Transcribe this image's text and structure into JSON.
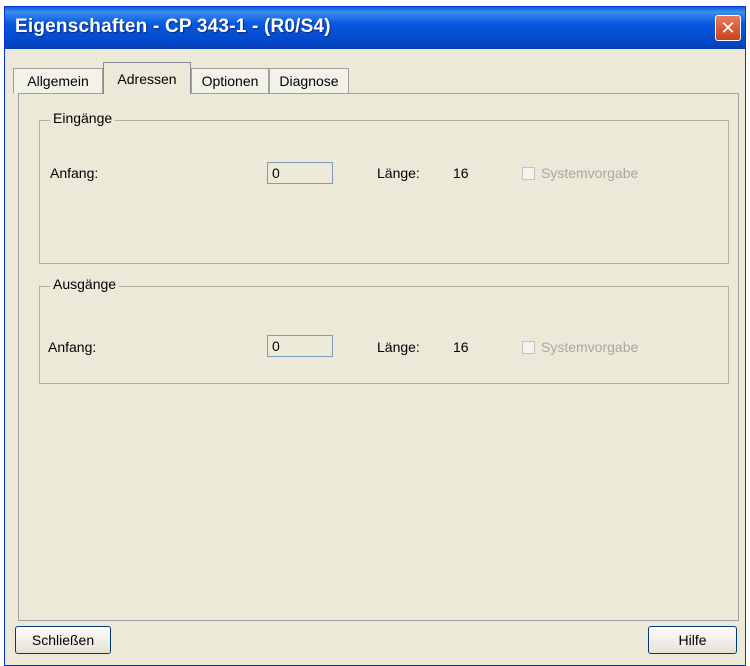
{
  "window": {
    "title": "Eigenschaften - CP 343-1 - (R0/S4)",
    "close_glyph": "✕"
  },
  "tabs": [
    {
      "label": "Allgemein",
      "active": false
    },
    {
      "label": "Adressen",
      "active": true
    },
    {
      "label": "Optionen",
      "active": false
    },
    {
      "label": "Diagnose",
      "active": false
    }
  ],
  "inputs_group": {
    "title": "Eingänge",
    "start_label": "Anfang:",
    "start_value": "0",
    "length_label": "Länge:",
    "length_value": "16",
    "default_label": "Systemvorgabe",
    "default_checked": false
  },
  "outputs_group": {
    "title": "Ausgänge",
    "start_label": "Anfang:",
    "start_value": "0",
    "length_label": "Länge:",
    "length_value": "16",
    "default_label": "Systemvorgabe",
    "default_checked": false
  },
  "footer": {
    "close_label": "Schließen",
    "help_label": "Hilfe"
  }
}
